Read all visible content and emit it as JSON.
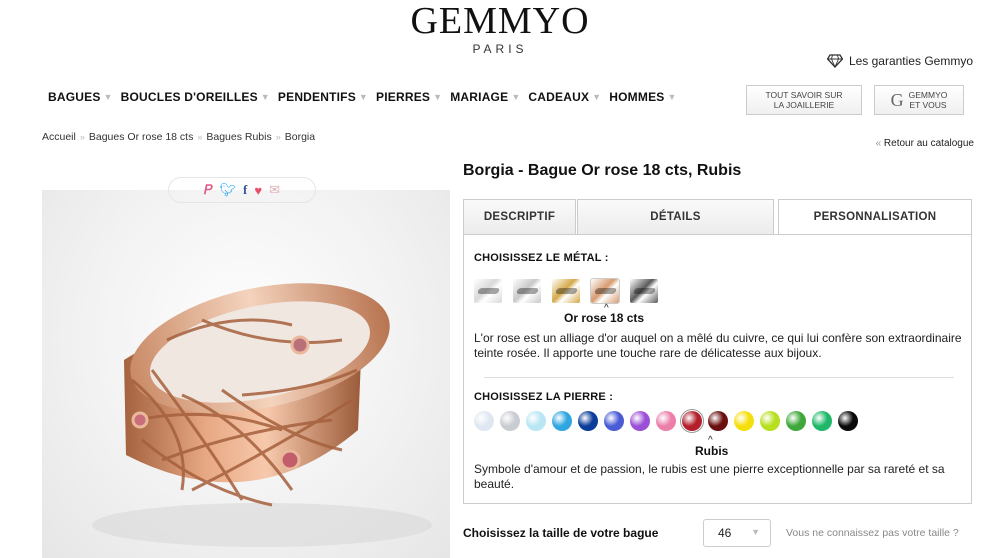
{
  "header": {
    "brand": "GEMMYO",
    "city": "PARIS",
    "guarantee": "Les garanties Gemmyo"
  },
  "nav": {
    "items": [
      {
        "label": "BAGUES",
        "has_menu": true
      },
      {
        "label": "BOUCLES D'OREILLES",
        "has_menu": true
      },
      {
        "label": "PENDENTIFS",
        "has_menu": true
      },
      {
        "label": "PIERRES",
        "has_menu": true
      },
      {
        "label": "MARIAGE",
        "has_menu": true
      },
      {
        "label": "CADEAUX",
        "has_menu": true
      },
      {
        "label": "HOMMES",
        "has_menu": true
      }
    ],
    "savoir_line1": "TOUT SAVOIR SUR",
    "savoir_line2": "LA JOAILLERIE",
    "vous_icon": "G",
    "vous_line1": "GEMMYO",
    "vous_line2": "ET VOUS"
  },
  "breadcrumb": [
    "Accueil",
    "Bagues Or rose 18 cts",
    "Bagues Rubis",
    "Borgia"
  ],
  "back_link": "Retour au catalogue",
  "share_icons": [
    "pinterest-icon",
    "twitter-icon",
    "facebook-icon",
    "heart-icon",
    "mail-icon"
  ],
  "product": {
    "title": "Borgia - Bague Or rose 18 cts, Rubis"
  },
  "tabs": [
    {
      "label": "DESCRIPTIF",
      "active": false
    },
    {
      "label": "DÉTAILS",
      "active": false
    },
    {
      "label": "PERSONNALISATION",
      "active": true
    }
  ],
  "personalization": {
    "metal_title": "CHOISISSEZ LE MÉTAL :",
    "metals": [
      {
        "name": "Or blanc",
        "color": "#d9d9d9"
      },
      {
        "name": "Argent",
        "color": "#c8c8c8"
      },
      {
        "name": "Or jaune",
        "color": "#d4a949"
      },
      {
        "name": "Or rose",
        "color": "#d89a70"
      },
      {
        "name": "Noir",
        "color": "#5a5a5a"
      }
    ],
    "selected_metal_index": 3,
    "selected_metal": "Or rose 18 cts",
    "metal_desc": "L'or rose est un alliage d'or auquel on a mêlé du cuivre, ce qui lui confère son extraordinaire teinte rosée. Il apporte une touche rare de délicatesse aux bijoux.",
    "stone_title": "CHOISISSEZ LA PIERRE :",
    "stones": [
      "#dfe8f2",
      "#c9cdd2",
      "#b9e6f3",
      "#2fa6e0",
      "#0b3c99",
      "#4a5bd6",
      "#9b4fd6",
      "#ec7fa9",
      "#b3202c",
      "#6a1010",
      "#f5df0b",
      "#b6e01e",
      "#3fa83a",
      "#1fb868",
      "#0a0a0a"
    ],
    "selected_stone_index": 8,
    "selected_stone": "Rubis",
    "stone_desc": "Symbole d'amour et de passion, le rubis est une pierre exceptionnelle par sa rareté et sa beauté."
  },
  "size": {
    "label": "Choisissez la taille de votre bague",
    "value": "46",
    "help": "Vous ne connaissez pas votre taille ?"
  }
}
